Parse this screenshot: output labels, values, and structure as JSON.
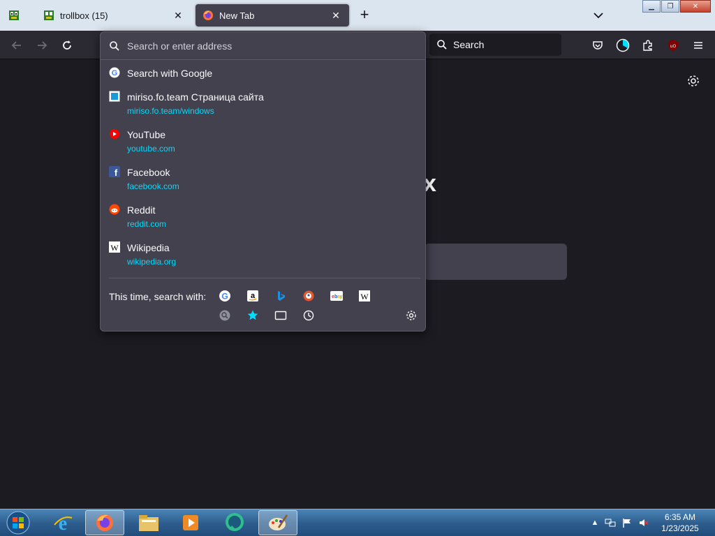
{
  "tabs": {
    "pinned_icon": "trollbox-icon",
    "inactive": {
      "title": "trollbox (15)",
      "icon": "trollbox-icon"
    },
    "active": {
      "title": "New Tab",
      "icon": "firefox-icon"
    },
    "new_tab": "+"
  },
  "navbar": {
    "search_placeholder": "Search"
  },
  "urlbar": {
    "placeholder": "Search or enter address",
    "results": [
      {
        "title": "Search with Google",
        "url": "",
        "icon": "google-icon"
      },
      {
        "title": "miriso.fo.team Страница сайта",
        "url": "miriso.fo.team/windows",
        "icon": "site-icon"
      },
      {
        "title": "YouTube",
        "url": "youtube.com",
        "icon": "youtube-icon"
      },
      {
        "title": "Facebook",
        "url": "facebook.com",
        "icon": "facebook-icon"
      },
      {
        "title": "Reddit",
        "url": "reddit.com",
        "icon": "reddit-icon"
      },
      {
        "title": "Wikipedia",
        "url": "wikipedia.org",
        "icon": "wikipedia-icon"
      }
    ],
    "oneoff_label": "This time, search with:",
    "oneoff_engines": [
      "google-icon",
      "amazon-icon",
      "bing-icon",
      "duckduckgo-icon",
      "ebay-icon",
      "wikipedia-icon"
    ],
    "oneoff_modes": [
      "search-tabs-icon",
      "bookmarks-star-icon",
      "tabs-icon",
      "history-icon"
    ]
  },
  "page": {
    "partial_heading": "x"
  },
  "taskbar": {
    "time": "6:35 AM",
    "date": "1/23/2025",
    "apps": [
      "internet-explorer-icon",
      "firefox-icon",
      "file-explorer-icon",
      "media-player-icon",
      "chat-app-icon",
      "paint-icon"
    ]
  },
  "colors": {
    "accent_url": "#00ddff",
    "popup_bg": "#42414d",
    "page_bg": "#1c1b22"
  }
}
